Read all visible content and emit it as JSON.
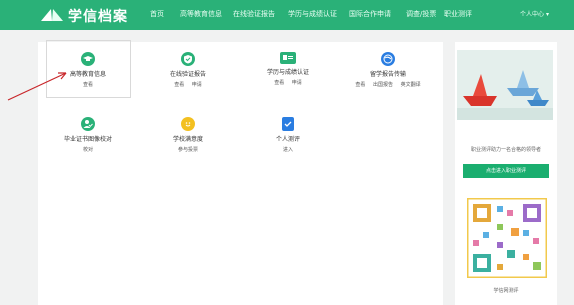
{
  "header": {
    "brand": "学信档案",
    "nav": [
      "首页",
      "高等教育信息",
      "在线验证报告",
      "学历与成绩认证",
      "国际合作申请",
      "调查/投票",
      "职业测评"
    ],
    "user": "个人中心"
  },
  "main": {
    "items": [
      {
        "title": "高等教育信息",
        "actions": [
          "查看"
        ]
      },
      {
        "title": "在线验证报告",
        "actions": [
          "查看",
          "申请"
        ]
      },
      {
        "title": "学历与成绩认证",
        "actions": [
          "查看",
          "申请"
        ]
      },
      {
        "title": "留学报告传输",
        "actions": [
          "查看",
          "出国报告",
          "英文翻译"
        ]
      },
      {
        "title": "毕业证书图像校对",
        "actions": [
          "校对"
        ]
      },
      {
        "title": "学校满意度",
        "actions": [
          "参与投票"
        ]
      },
      {
        "title": "个人测评",
        "actions": [
          "进入"
        ]
      }
    ]
  },
  "side": {
    "promo_text": "职业测评助力一名合格的领导者",
    "promo_button": "点击进入职业测评",
    "qr_caption": "学信网测评"
  },
  "colors": {
    "brand_green": "#2ab178",
    "accent_blue": "#2a7de1",
    "accent_yellow": "#f3c020",
    "arrow_red": "#c8262a"
  }
}
